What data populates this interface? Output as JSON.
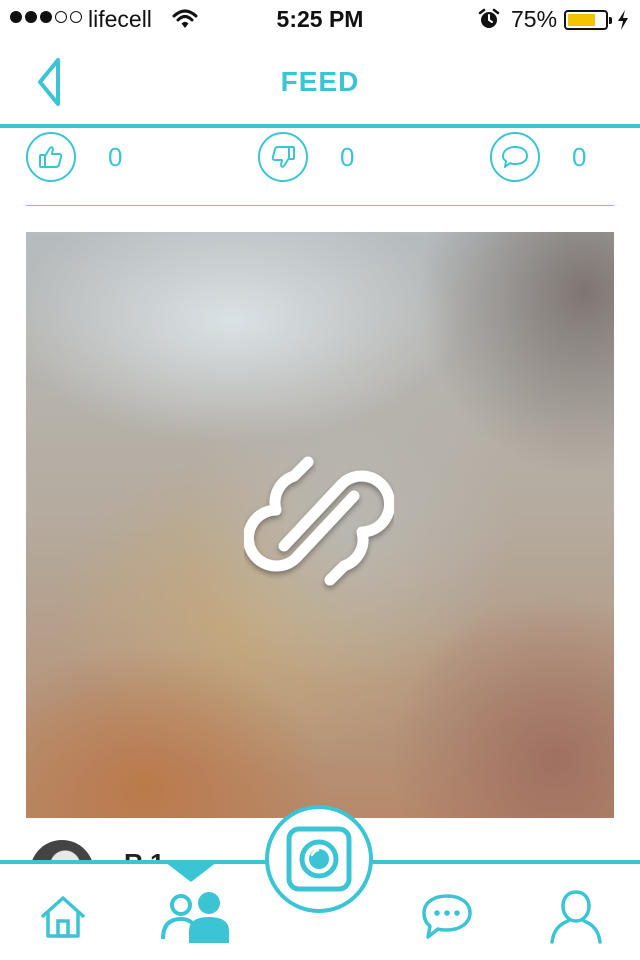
{
  "status_bar": {
    "carrier": "lifecell",
    "signal_filled": 3,
    "signal_total": 5,
    "time": "5:25 PM",
    "battery_percent": "75%",
    "battery_level": 0.75,
    "battery_color": "#f5c400",
    "icons": [
      "wifi-icon",
      "alarm-icon",
      "charging-bolt-icon"
    ]
  },
  "nav": {
    "title": "FEED",
    "back_icon": "chevron-left-icon"
  },
  "reactions": {
    "likes": "0",
    "dislikes": "0",
    "comments": "0",
    "icons": [
      "thumbs-up-icon",
      "thumbs-down-icon",
      "comment-icon"
    ]
  },
  "post": {
    "placeholder_icon": "app-logo-icon"
  },
  "next_post": {
    "author_partial": "R    1"
  },
  "tab_bar": {
    "items": [
      "home-icon",
      "friends-icon",
      "camera-icon",
      "chat-icon",
      "profile-icon"
    ],
    "active": "friends-icon"
  },
  "colors": {
    "accent": "#3bc4d4",
    "text_dark": "#111111",
    "background": "#ffffff"
  }
}
